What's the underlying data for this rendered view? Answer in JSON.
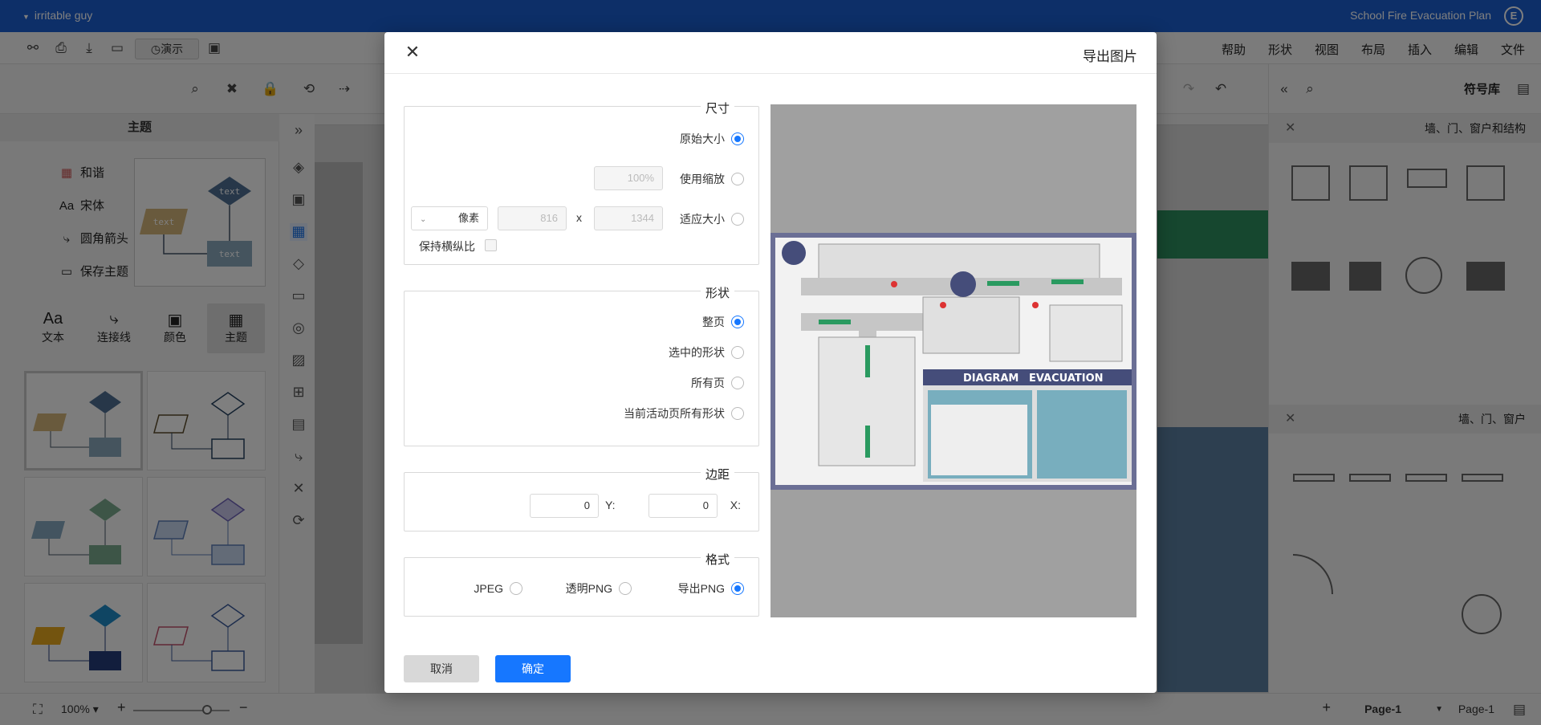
{
  "titlebar": {
    "doc_title": "School Fire Evacuation Plan",
    "user": "irritable guy",
    "logo_letter": "E"
  },
  "menus": [
    "文件",
    "编辑",
    "插入",
    "布局",
    "视图",
    "形状",
    "帮助"
  ],
  "toolbar": {
    "present_label": "演示"
  },
  "left_panel": {
    "header": "主题",
    "quick": [
      {
        "icon": "grid-icon",
        "label": "和谐"
      },
      {
        "icon": "font-icon",
        "label": "宋体"
      },
      {
        "icon": "connector-icon",
        "label": "圆角箭头"
      },
      {
        "icon": "save-icon",
        "label": "保存主题"
      }
    ],
    "tabs": [
      {
        "icon": "▦",
        "label": "主题"
      },
      {
        "icon": "▣",
        "label": "颜色"
      },
      {
        "icon": "⤷",
        "label": "连接线"
      },
      {
        "icon": "Aa",
        "label": "文本"
      }
    ],
    "preview_text": [
      "text",
      "text",
      "text"
    ]
  },
  "right_panel": {
    "title": "符号库",
    "sections": [
      {
        "name": "墙、门、窗户和结构"
      },
      {
        "name": "墙、门、窗户"
      }
    ]
  },
  "bottombar": {
    "page_tab": "Page-1",
    "page_select": "Page-1",
    "zoom": "100%"
  },
  "dialog": {
    "title": "导出图片",
    "size": {
      "legend": "尺寸",
      "original": "原始大小",
      "use_scale": "使用缩放",
      "scale_placeholder": "100%",
      "fit_size": "适应大小",
      "width_placeholder": "1344",
      "x_sep": "x",
      "height_placeholder": "816",
      "unit": "像素",
      "keep_ratio": "保持横纵比"
    },
    "shape": {
      "legend": "形状",
      "whole_page": "整页",
      "selected_shapes": "选中的形状",
      "all_pages": "所有页",
      "active_page_shapes": "当前活动页所有形状"
    },
    "margin": {
      "legend": "边距",
      "x_label": "X:",
      "x_value": "0",
      "y_label": "Y:",
      "y_value": "0"
    },
    "format": {
      "legend": "格式",
      "png": "导出PNG",
      "transparent_png": "透明PNG",
      "jpeg": "JPEG"
    },
    "ok": "确定",
    "cancel": "取消",
    "preview_labels": {
      "evacuation": "EVACUATION",
      "diagram": "DIAGRAM"
    }
  },
  "colors": {
    "accent": "#1677ff",
    "titlebar": "#1b5fd1",
    "preview_bg": "#6b6f95"
  }
}
